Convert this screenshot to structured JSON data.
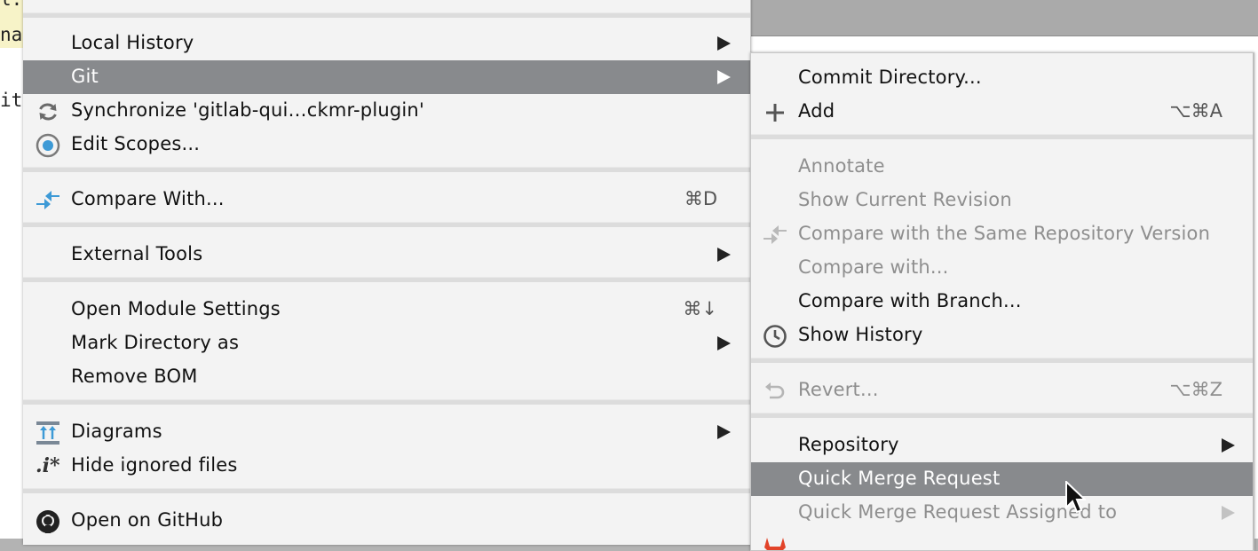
{
  "editor": {
    "line1": "l.ja",
    "line2": "nal",
    "line3": "it"
  },
  "left_menu": {
    "local_history": "Local History",
    "git": "Git",
    "synchronize": "Synchronize 'gitlab-qui…ckmr-plugin'",
    "edit_scopes": "Edit Scopes...",
    "compare_with": "Compare With...",
    "compare_with_shortcut": "⌘D",
    "external_tools": "External Tools",
    "open_module_settings": "Open Module Settings",
    "open_module_settings_shortcut": "⌘↓",
    "mark_directory_as": "Mark Directory as",
    "remove_bom": "Remove BOM",
    "diagrams": "Diagrams",
    "hide_ignored_files": "Hide ignored files",
    "hide_ignored_icon_text": ".i*",
    "open_on_github": "Open on GitHub"
  },
  "git_submenu": {
    "commit_directory": "Commit Directory...",
    "add": "Add",
    "add_shortcut": "⌥⌘A",
    "annotate": "Annotate",
    "show_current_revision": "Show Current Revision",
    "compare_same_repo": "Compare with the Same Repository Version",
    "compare_with": "Compare with...",
    "compare_with_branch": "Compare with Branch...",
    "show_history": "Show History",
    "revert": "Revert...",
    "revert_shortcut": "⌥⌘Z",
    "repository": "Repository",
    "quick_merge_request": "Quick Merge Request",
    "quick_merge_request_assigned": "Quick Merge Request Assigned to"
  },
  "colors": {
    "menu_bg": "#f3f3f3",
    "selection": "#888a8d",
    "disabled_text": "#8e8e8e",
    "accent_blue": "#3d9ad6"
  }
}
